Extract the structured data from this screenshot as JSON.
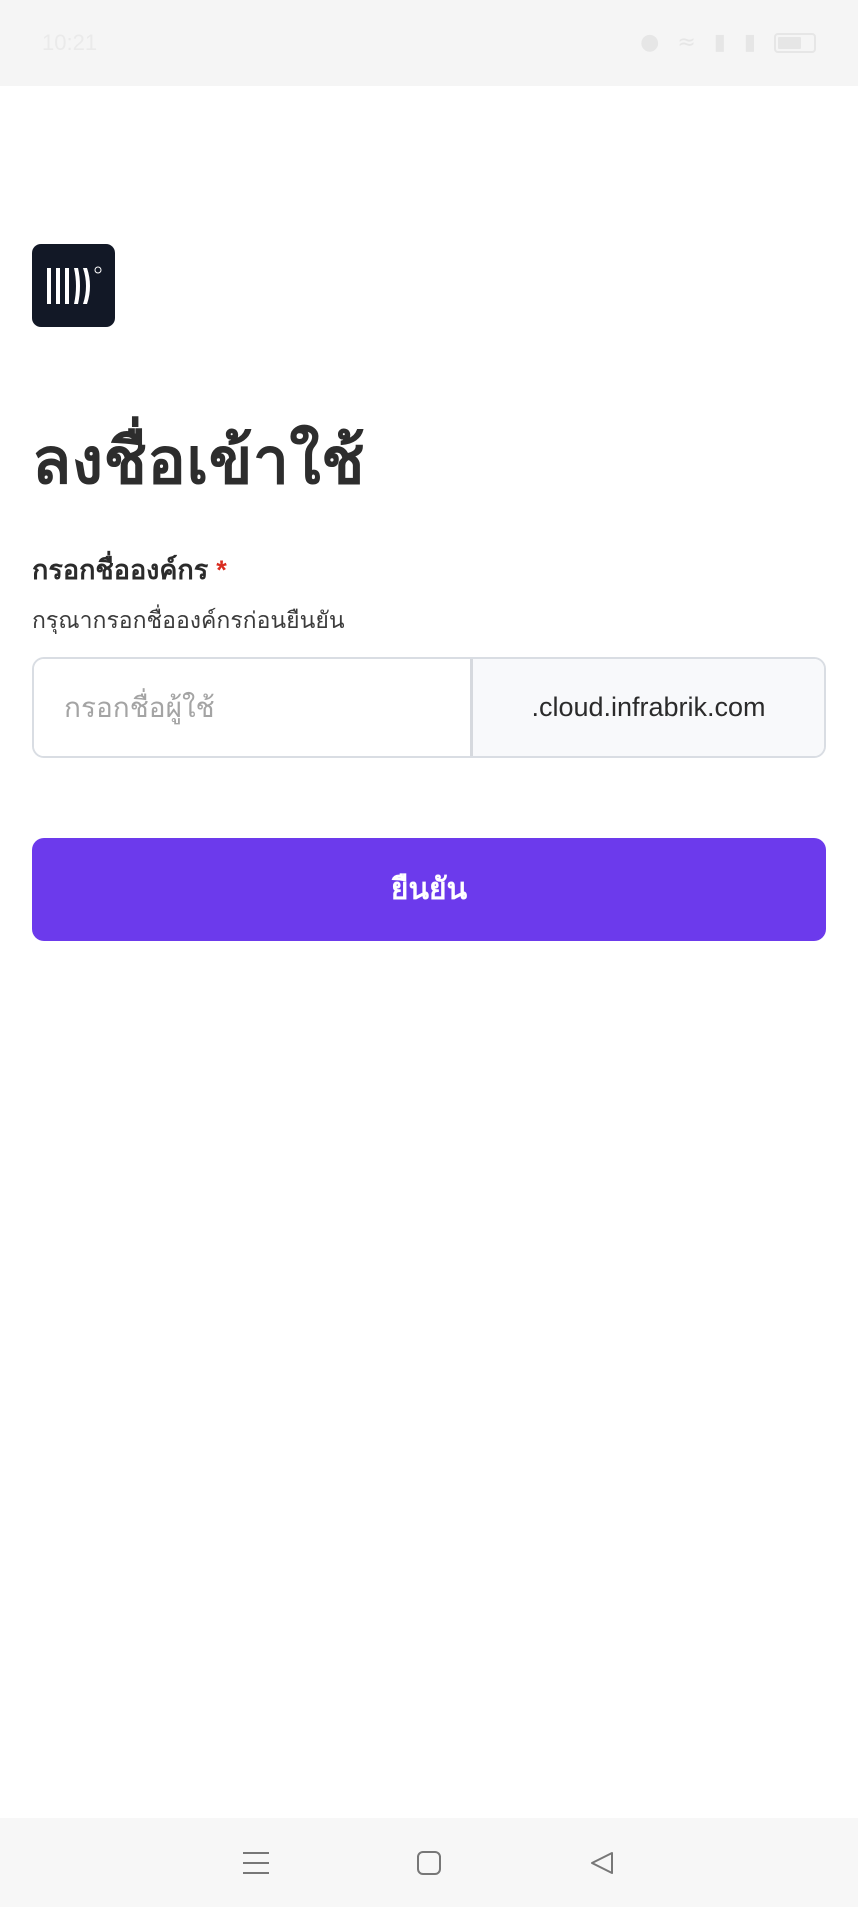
{
  "status_bar": {
    "time": "10:21",
    "icons": [
      "location-icon",
      "wifi-icon",
      "signal-icon",
      "signal-icon",
      "battery-icon"
    ]
  },
  "logo": {
    "icon": "brand-logo"
  },
  "page": {
    "title": "ลงชื่อเข้าใช้"
  },
  "form": {
    "label": "กรอกชื่อองค์กร",
    "required_mark": "*",
    "help_text": "กรุณากรอกชื่อองค์กรก่อนยืนยัน",
    "org_input": {
      "value": "",
      "placeholder": "กรอกชื่อผู้ใช้"
    },
    "domain_suffix": ".cloud.infrabrik.com",
    "confirm_label": "ยืนยัน"
  },
  "colors": {
    "primary": "#6c3aec",
    "required": "#d92d20",
    "logo_bg": "#121826"
  },
  "nav_bar": {
    "buttons": [
      "menu-icon",
      "home-icon",
      "back-icon"
    ]
  }
}
